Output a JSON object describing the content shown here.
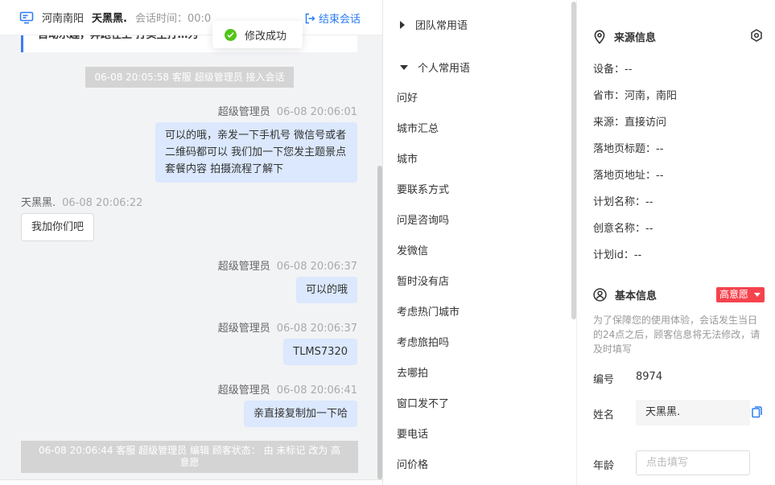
{
  "header": {
    "location": "河南南阳",
    "customer_name": "天黑黑.",
    "session_time_label": "会话时间：00:0",
    "end_session_label": "结束会话"
  },
  "notice": {
    "text": "自动乐趣，奔跑在上 打卖主打…为"
  },
  "toast": {
    "text": "修改成功"
  },
  "messages": [
    {
      "kind": "system",
      "text": "06-08 20:05:58 客服 超级管理员 接入会话"
    },
    {
      "kind": "agent",
      "sender": "超级管理员",
      "time": "06-08 20:06:01",
      "lines": [
        "可以的哦，亲发一下手机号 微信号或者",
        "二维码都可以 我们加一下您发主题景点",
        "套餐内容 拍摄流程了解下"
      ]
    },
    {
      "kind": "customer",
      "sender": "天黑黑.",
      "time": "06-08 20:06:22",
      "text": "我加你们吧"
    },
    {
      "kind": "agent",
      "sender": "超级管理员",
      "time": "06-08 20:06:37",
      "text": "可以的哦"
    },
    {
      "kind": "agent",
      "sender": "超级管理员",
      "time": "06-08 20:06:37",
      "text": "TLMS7320"
    },
    {
      "kind": "agent",
      "sender": "超级管理员",
      "time": "06-08 20:06:41",
      "text": "亲直接复制加一下哈"
    },
    {
      "kind": "system",
      "lines": [
        "06-08 20:06:44 客服 超级管理员 编辑 顾客状态： 由 未标记 改为 高",
        "意愿"
      ]
    }
  ],
  "phrases": {
    "team_group": "团队常用语",
    "personal_group": "个人常用语",
    "items": [
      "问好",
      "城市汇总",
      "城市",
      "要联系方式",
      "问是咨询吗",
      "发微信",
      "暂时没有店",
      "考虑热门城市",
      "考虑旅拍吗",
      "去哪拍",
      "窗口发不了",
      "要电话",
      "问价格"
    ]
  },
  "source_info": {
    "title": "来源信息",
    "rows": [
      "设备：--",
      "省市：河南，南阳",
      "来源：直接访问",
      "落地页标题：--",
      "落地页地址：--",
      "计划名称：--",
      "创意名称：--",
      "计划id：--"
    ]
  },
  "basic_info": {
    "title": "基本信息",
    "intent_badge": "高意愿",
    "tip": "为了保障您的使用体验，会话发生当日的24点之后，顾客信息将无法修改，请及时填写",
    "id_label": "编号",
    "id_value": "8974",
    "name_label": "姓名",
    "name_value": "天黑黑.",
    "age_label": "年龄",
    "age_placeholder": "点击填写"
  },
  "colors": {
    "accent": "#2b7cf6",
    "agent_bubble": "#dbe8fd",
    "badge": "#f5434e",
    "success": "#52c41a"
  },
  "icons": [
    "monitor-icon",
    "logout-icon",
    "check-circle-icon",
    "location-pin-icon",
    "settings-icon",
    "user-icon",
    "copy-icon"
  ]
}
